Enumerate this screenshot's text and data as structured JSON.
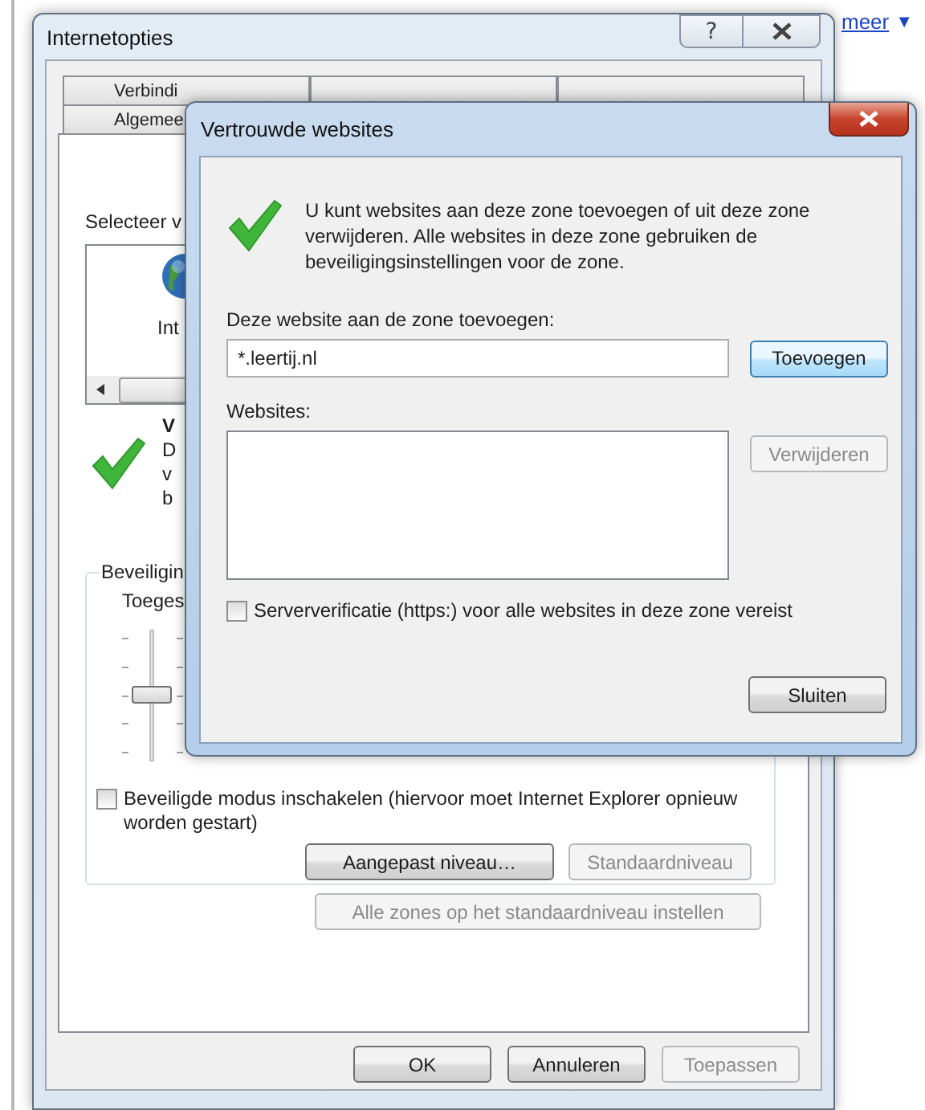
{
  "browser": {
    "link": "meer",
    "link_icon": "▼"
  },
  "options_window": {
    "title": "Internetopties",
    "help_glyph": "?",
    "tab_rows": [
      {
        "tabs": [
          {
            "label": "Verbindi",
            "selected": false
          },
          {
            "selected": false
          },
          {
            "selected": false
          }
        ]
      },
      {
        "tabs": [
          {
            "label": "Algemee",
            "selected": false
          }
        ]
      }
    ],
    "zone_prompt": "Selecteer v",
    "zone_item": "Int",
    "zone_title": "V",
    "zone_description": [
      "D",
      "v",
      "b"
    ],
    "security_group": {
      "legend": "Beveiligin",
      "label": "Toeges",
      "slider": {
        "level": 0.5
      },
      "protected_mode": {
        "label": "Beveiligde modus inschakelen (hiervoor moet Internet Explorer opnieuw worden gestart)",
        "checked": false
      },
      "buttons": [
        {
          "label": "Aangepast niveau…",
          "disabled": false
        },
        {
          "label": "Standaardniveau",
          "disabled": true
        }
      ]
    },
    "reset_button": {
      "label": "Alle zones op het standaardniveau instellen",
      "disabled": true
    },
    "buttons": [
      {
        "label": "OK",
        "disabled": false
      },
      {
        "label": "Annuleren",
        "disabled": false
      },
      {
        "label": "Toepassen",
        "disabled": true
      }
    ]
  },
  "dialog": {
    "title": "Vertrouwde websites",
    "description": "U kunt websites aan deze zone toevoegen of uit deze zone verwijderen. Alle websites in deze zone gebruiken de beveiligingsinstellingen voor de zone.",
    "add_label": "Deze website aan de zone toevoegen:",
    "add_field": {
      "value": "*.leertij.nl"
    },
    "add_button": {
      "label": "Toevoegen",
      "disabled": false,
      "default": true
    },
    "websites_label": "Websites:",
    "remove_button": {
      "label": "Verwijderen",
      "disabled": true
    },
    "https_check": {
      "label": "Serververificatie (https:) voor alle websites in deze zone vereist",
      "checked": false
    },
    "close_button": {
      "label": "Sluiten",
      "disabled": false
    }
  }
}
